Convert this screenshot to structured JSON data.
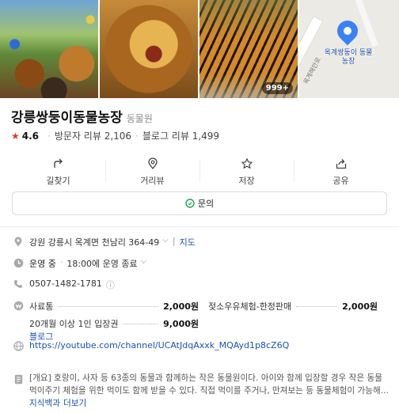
{
  "photos": {
    "items": [
      "lion-collage",
      "lion-roaring",
      "tiger-walking"
    ],
    "count_badge": "999+",
    "map": {
      "place_label": "옥계쌍둥이 동물농장",
      "road_label": "옥계해안로"
    }
  },
  "place": {
    "name": "강릉쌍둥이동물농장",
    "category": "동물원",
    "rating": "4.6",
    "visitor_reviews": "방문자 리뷰 2,106",
    "blog_reviews": "블로그 리뷰 1,499"
  },
  "actions": [
    {
      "label": "길찾기",
      "icon": "directions-icon"
    },
    {
      "label": "거리뷰",
      "icon": "street-view-icon"
    },
    {
      "label": "저장",
      "icon": "star-outline-icon"
    },
    {
      "label": "공유",
      "icon": "share-icon"
    }
  ],
  "inquiry": {
    "label": "문의",
    "icon": "chat-icon"
  },
  "info": {
    "address": "강원 강릉시 옥계면 천남리 364-49",
    "address_map_link": "지도",
    "status": "운영 중",
    "hours": "18:00에 운영 종료",
    "phone": "0507-1482-1781",
    "prices": [
      {
        "name": "사료통",
        "price": "2,000원"
      },
      {
        "name": "젖소우유체험-한정판매",
        "price": "2,000원"
      },
      {
        "name": "20개월 이상 1인 입장권",
        "price": "9,000원"
      }
    ],
    "blog_link": "블로그",
    "website": "https://youtube.com/channel/UCAtJdqAxxk_MQAyd1p8cZ6Q",
    "description": "[개요] 호랑이, 사자 등 63종의 동물과 함께하는 작은 동물원이다. 아이와 함께 입장할 경우 작은 동물 먹이주기 체험을 위한 먹이도 함께 받을 수 있다. 직접 먹이를 주거나, 만져보는 등 동물체험이 가능해...",
    "description_source": "지식백과",
    "description_more": "더보기"
  },
  "colors": {
    "accent_blue": "#1b4fb8",
    "star_red": "#e0353b",
    "pin_blue": "#3b82f6"
  }
}
